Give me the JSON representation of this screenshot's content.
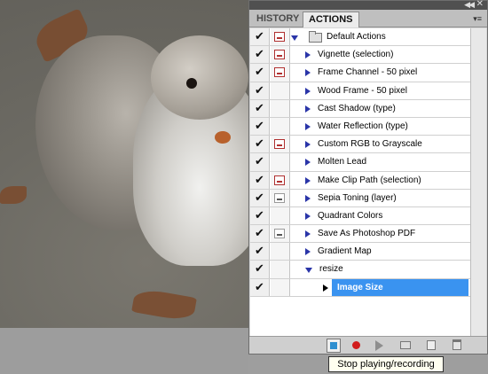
{
  "panel": {
    "tabs": [
      "HISTORY",
      "ACTIONS"
    ],
    "active_tab": "ACTIONS"
  },
  "actions": {
    "rows": [
      {
        "type": "set",
        "label": "Default Actions",
        "dialog": "red"
      },
      {
        "type": "action",
        "label": "Vignette (selection)",
        "dialog": "red"
      },
      {
        "type": "action",
        "label": "Frame Channel - 50 pixel",
        "dialog": "red"
      },
      {
        "type": "action",
        "label": "Wood Frame - 50 pixel",
        "dialog": "none"
      },
      {
        "type": "action",
        "label": "Cast Shadow (type)",
        "dialog": "none"
      },
      {
        "type": "action",
        "label": "Water Reflection (type)",
        "dialog": "none"
      },
      {
        "type": "action",
        "label": "Custom RGB to Grayscale",
        "dialog": "red"
      },
      {
        "type": "action",
        "label": "Molten Lead",
        "dialog": "none"
      },
      {
        "type": "action",
        "label": "Make Clip Path (selection)",
        "dialog": "red"
      },
      {
        "type": "action",
        "label": "Sepia Toning (layer)",
        "dialog": "gray"
      },
      {
        "type": "action",
        "label": "Quadrant Colors",
        "dialog": "none"
      },
      {
        "type": "action",
        "label": "Save As Photoshop PDF",
        "dialog": "gray"
      },
      {
        "type": "action",
        "label": "Gradient Map",
        "dialog": "none"
      },
      {
        "type": "open-action",
        "label": "resize",
        "dialog": "none"
      },
      {
        "type": "step",
        "label": "Image Size",
        "dialog": "none"
      }
    ]
  },
  "tooltip": {
    "text": "Stop playing/recording"
  }
}
